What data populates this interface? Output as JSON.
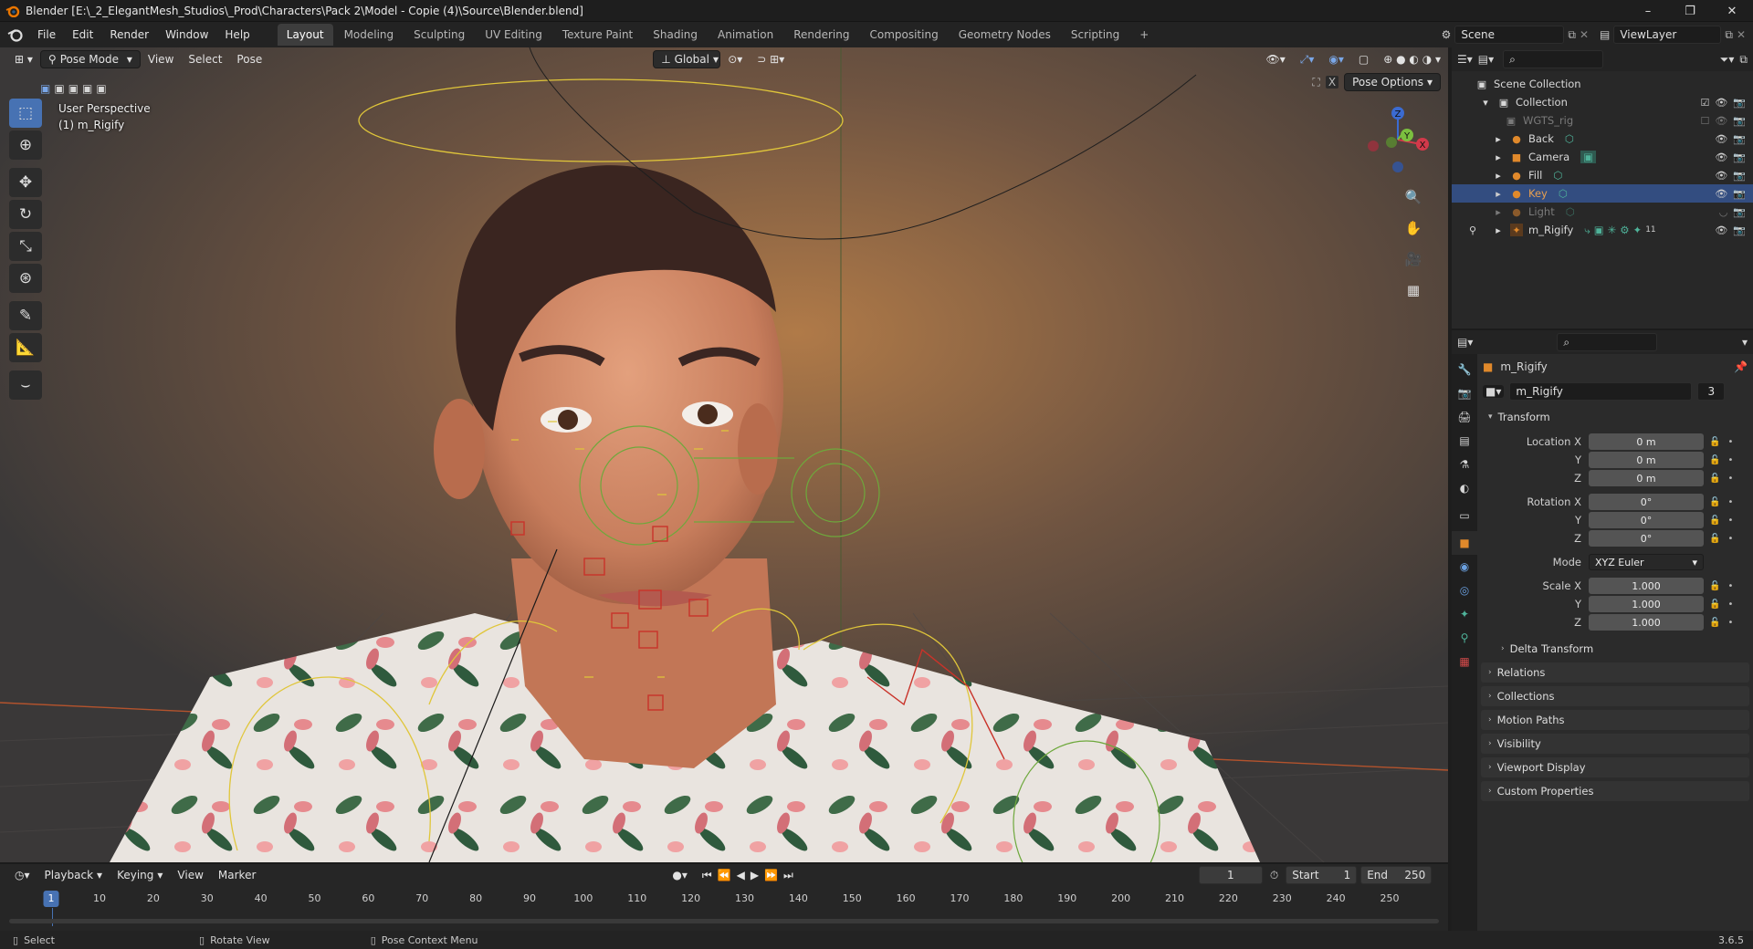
{
  "window": {
    "title": "Blender [E:\\_2_ElegantMesh_Studios\\_Prod\\Characters\\Pack 2\\Model - Copie (4)\\Source\\Blender.blend]",
    "controls": [
      "–",
      "❐",
      "✕"
    ]
  },
  "menu": [
    "File",
    "Edit",
    "Render",
    "Window",
    "Help"
  ],
  "workspaces": [
    "Layout",
    "Modeling",
    "Sculpting",
    "UV Editing",
    "Texture Paint",
    "Shading",
    "Animation",
    "Rendering",
    "Compositing",
    "Geometry Nodes",
    "Scripting",
    "+"
  ],
  "active_workspace": "Layout",
  "scene": {
    "name": "Scene",
    "view_layer": "ViewLayer"
  },
  "viewport": {
    "mode": "Pose Mode",
    "menus": [
      "View",
      "Select",
      "Pose"
    ],
    "orientation": "Global",
    "pose_options": "Pose Options",
    "overlay_title": "User Perspective",
    "overlay_object": "(1) m_Rigify",
    "gizmo_axes": {
      "x": "X",
      "y": "Y",
      "z": "Z"
    }
  },
  "outliner": {
    "root": "Scene Collection",
    "collection": "Collection",
    "items": [
      {
        "name": "WGTS_rig",
        "dim": true
      },
      {
        "name": "Back",
        "dim": false
      },
      {
        "name": "Camera",
        "dim": false
      },
      {
        "name": "Fill",
        "dim": false
      },
      {
        "name": "Key",
        "dim": false,
        "selected": true
      },
      {
        "name": "Light",
        "dim": true
      },
      {
        "name": "m_Rigify",
        "dim": false,
        "count": "11"
      }
    ]
  },
  "properties": {
    "object_name": "m_Rigify",
    "datablock": "m_Rigify",
    "users": "3",
    "transform_title": "Transform",
    "location": {
      "label": "Location X",
      "x": "0 m",
      "y": "0 m",
      "z": "0 m"
    },
    "rotation": {
      "label": "Rotation X",
      "x": "0°",
      "y": "0°",
      "z": "0°"
    },
    "mode_label": "Mode",
    "mode_value": "XYZ Euler",
    "scale": {
      "label": "Scale X",
      "x": "1.000",
      "y": "1.000",
      "z": "1.000"
    },
    "axis_y": "Y",
    "axis_z": "Z",
    "delta": "Delta Transform",
    "panels": [
      "Relations",
      "Collections",
      "Motion Paths",
      "Visibility",
      "Viewport Display",
      "Custom Properties"
    ]
  },
  "timeline": {
    "menus": [
      "Playback",
      "Keying",
      "View",
      "Marker"
    ],
    "current_frame": "1",
    "start_label": "Start",
    "start": "1",
    "end_label": "End",
    "end": "250",
    "ticks": [
      "10",
      "20",
      "30",
      "40",
      "50",
      "60",
      "70",
      "80",
      "90",
      "100",
      "110",
      "120",
      "130",
      "140",
      "150",
      "160",
      "170",
      "180",
      "190",
      "200",
      "210",
      "220",
      "230",
      "240",
      "250"
    ]
  },
  "status": {
    "select": "Select",
    "rotate": "Rotate View",
    "context": "Pose Context Menu",
    "version": "3.6.5"
  },
  "colors": {
    "accent": "#4772b3",
    "selection_row": "#334d80",
    "rig_yellow": "#e0c63a",
    "rig_green": "#6ea83c",
    "rig_red": "#c9332a"
  }
}
